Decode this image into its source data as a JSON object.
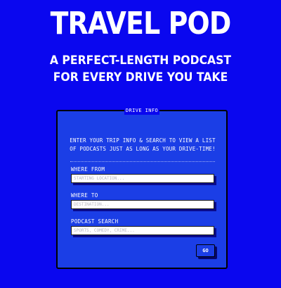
{
  "header": {
    "title": "TRAVEL POD",
    "subtitle_line1": "A PERFECT-LENGTH PODCAST",
    "subtitle_line2": "FOR EVERY DRIVE YOU TAKE"
  },
  "form": {
    "legend": "DRIVE INFO",
    "intro_line1": "ENTER YOUR TRIP INFO & SEARCH TO VIEW A LIST",
    "intro_line2": "OF PODCASTS JUST AS LONG AS YOUR DRIVE-TIME!",
    "from": {
      "label": "WHERE FROM",
      "placeholder": "STARTING LOCATION...",
      "value": ""
    },
    "to": {
      "label": "WHERE TO",
      "placeholder": "DESTINATION...",
      "value": ""
    },
    "search": {
      "label": "PODCAST SEARCH",
      "placeholder": "SPORTS, COMEDY, CRIME...",
      "value": ""
    },
    "go_label": "GO"
  },
  "colors": {
    "background": "#0a07ef",
    "panel": "#1b3ee6",
    "text": "#ffffff"
  }
}
